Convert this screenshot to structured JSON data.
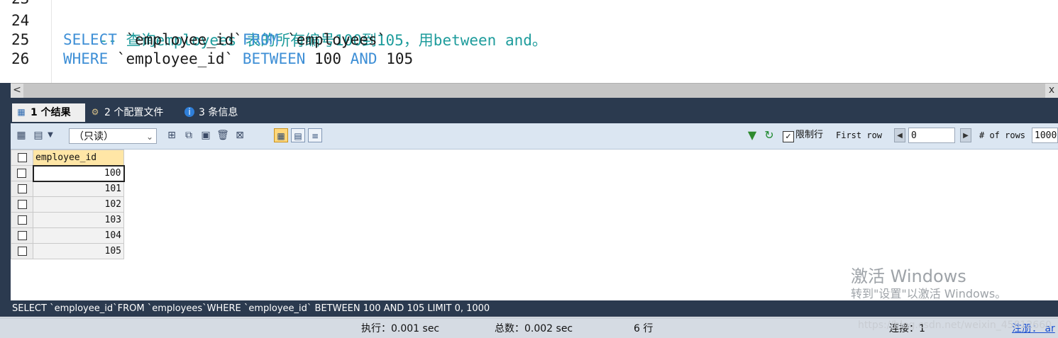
{
  "editor": {
    "lines": [
      {
        "num": "23",
        "parts": []
      },
      {
        "num": "24",
        "parts": [
          {
            "t": "-- 查询employees 表的所有编号100到105，用between and。",
            "c": "cmt"
          }
        ]
      },
      {
        "num": "25",
        "parts": [
          {
            "t": "SELECT",
            "c": "kw"
          },
          {
            "t": " `employee_id`",
            "c": "plain"
          },
          {
            "t": "FROM",
            "c": "kw"
          },
          {
            "t": " `employees`",
            "c": "plain"
          }
        ]
      },
      {
        "num": "26",
        "parts": [
          {
            "t": "WHERE",
            "c": "kw"
          },
          {
            "t": " `employee_id` ",
            "c": "plain"
          },
          {
            "t": "BETWEEN",
            "c": "kw"
          },
          {
            "t": " 100 ",
            "c": "plain"
          },
          {
            "t": "AND",
            "c": "kw"
          },
          {
            "t": " 105",
            "c": "plain"
          }
        ]
      }
    ]
  },
  "scrollbar": {
    "left_arrow": "<",
    "right_arrow": "x"
  },
  "tabs": [
    {
      "label": "1 个结果",
      "icon": "grid-icon",
      "active": true
    },
    {
      "label": "2 个配置文件",
      "icon": "profile-icon",
      "active": false
    },
    {
      "label": "3 条信息",
      "icon": "info-icon",
      "active": false
    }
  ],
  "toolbar": {
    "mode": "（只读）",
    "limit_label": "限制行",
    "first_row_label": "First row",
    "first_row_value": "0",
    "rows_label": "# of rows",
    "rows_value": "1000"
  },
  "grid": {
    "column": "employee_id",
    "rows": [
      "100",
      "101",
      "102",
      "103",
      "104",
      "105"
    ]
  },
  "watermark": {
    "title": "激活 Windows",
    "subtitle": "转到\"设置\"以激活 Windows。"
  },
  "sql_status": "SELECT `employee_id`FROM `employees`WHERE `employee_id` BETWEEN 100 AND 105 LIMIT 0, 1000",
  "status": {
    "exec": "执行：0.001 sec",
    "total": "总数：0.002 sec",
    "rows": "6 行",
    "conn": "连接：1",
    "register": "注册： ar"
  },
  "csdn_watermark": "https://blog.csdn.net/weixin_45812660",
  "colors": {
    "keyword": "#3e8fd6",
    "comment": "#1e9c9c",
    "header": "#2b3a4f",
    "column_header": "#ffe6a6"
  }
}
